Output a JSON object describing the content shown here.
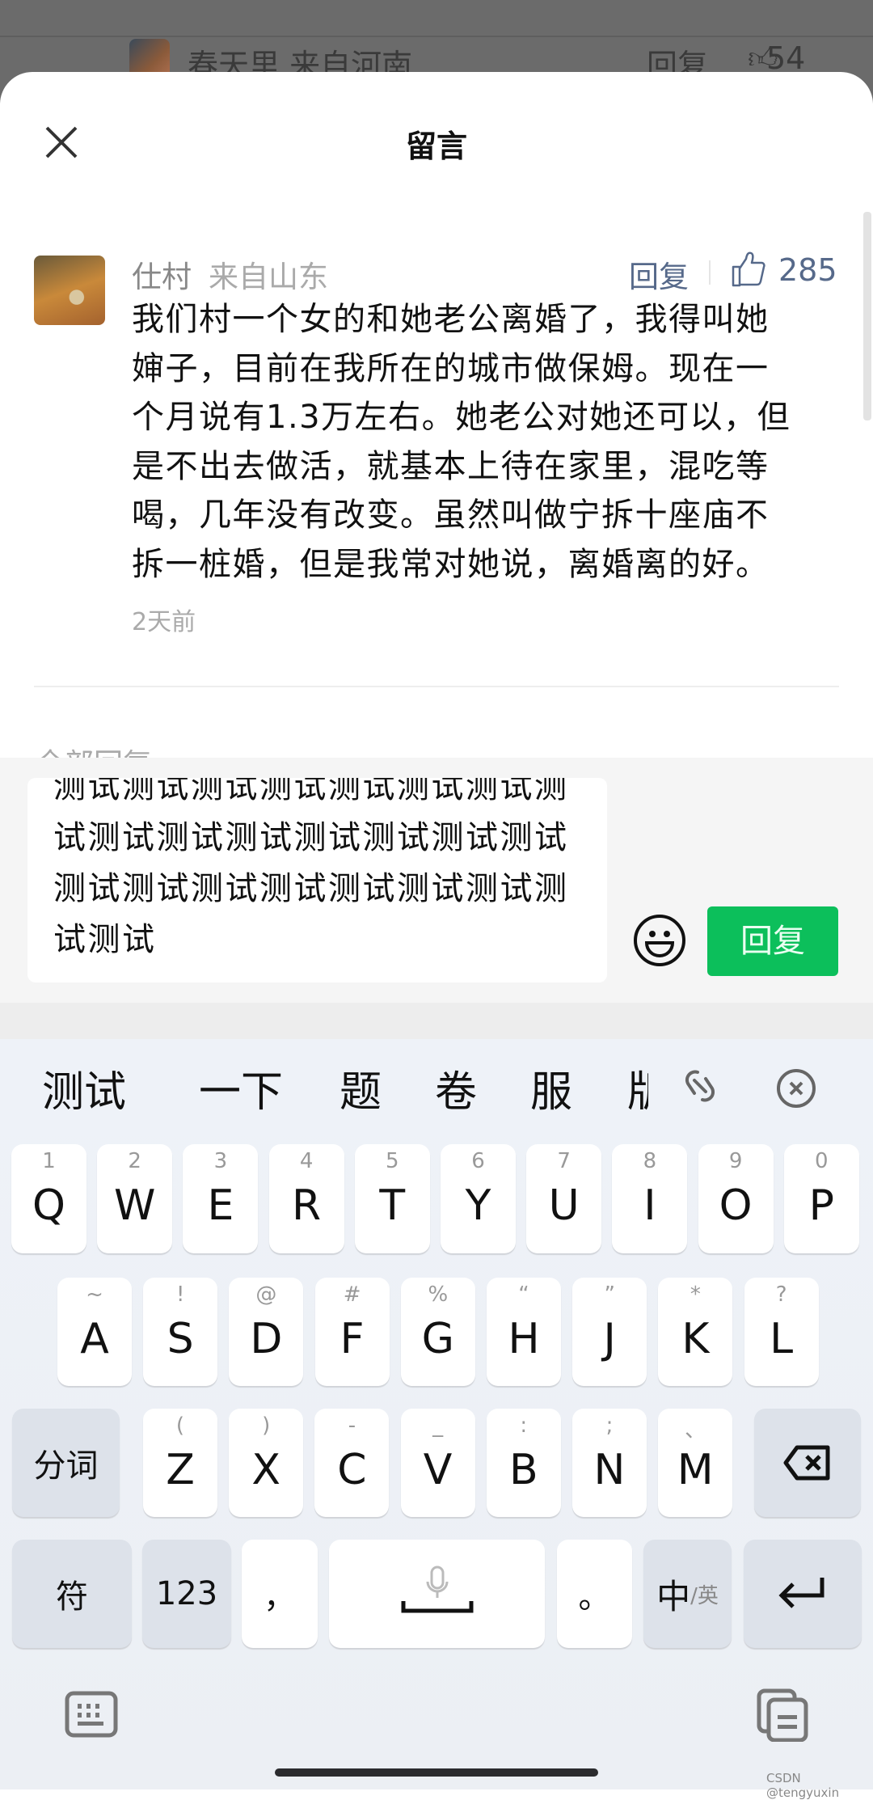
{
  "background": {
    "name": "春天里 来自河南",
    "reply": "回复",
    "likes": "54"
  },
  "header": {
    "title": "留言"
  },
  "comment": {
    "author": "仕村",
    "location": "来自山东",
    "reply_label": "回复",
    "likes": "285",
    "lines": [
      "我们村一个女的和她老公离婚了，我得叫她",
      "婶子，目前在我所在的城市做保姆。现在一",
      "个月说有1.3万左右。她老公对她还可以，但",
      "是不出去做活，就基本上待在家里，混吃等",
      "喝，几年没有改变。虽然叫做宁拆十座庙不",
      "拆一桩婚，但是我常对她说，离婚离的好。"
    ],
    "time": "2天前"
  },
  "all_replies": "全部回复",
  "input": {
    "lines": [
      "测试测试测试测试测试测试测试测",
      "试测试测试测试测试测试测试测试",
      "测试测试测试测试测试测试测试测",
      "试测试"
    ]
  },
  "send_label": "回复",
  "accent": "#0cbf5b",
  "keyboard": {
    "candidates": [
      "测试",
      "一下",
      "题",
      "卷",
      "服",
      "版"
    ],
    "row1": [
      [
        "1",
        "Q"
      ],
      [
        "2",
        "W"
      ],
      [
        "3",
        "E"
      ],
      [
        "4",
        "R"
      ],
      [
        "5",
        "T"
      ],
      [
        "6",
        "Y"
      ],
      [
        "7",
        "U"
      ],
      [
        "8",
        "I"
      ],
      [
        "9",
        "O"
      ],
      [
        "0",
        "P"
      ]
    ],
    "row2": [
      [
        "~",
        "A"
      ],
      [
        "!",
        "S"
      ],
      [
        "@",
        "D"
      ],
      [
        "#",
        "F"
      ],
      [
        "%",
        "G"
      ],
      [
        "“",
        "H"
      ],
      [
        "”",
        "J"
      ],
      [
        "*",
        "K"
      ],
      [
        "?",
        "L"
      ]
    ],
    "row3": [
      [
        "(",
        "Z"
      ],
      [
        ")",
        "X"
      ],
      [
        "-",
        "C"
      ],
      [
        "_",
        "V"
      ],
      [
        ":",
        "B"
      ],
      [
        ";",
        "N"
      ],
      [
        "、",
        "M"
      ]
    ],
    "segment_label": "分词",
    "symbol_label": "符",
    "num_label": "123",
    "comma": "，",
    "period": "。",
    "lang_main": "中",
    "lang_sub": "/英"
  },
  "watermark": "CSDN @tengyuxin"
}
